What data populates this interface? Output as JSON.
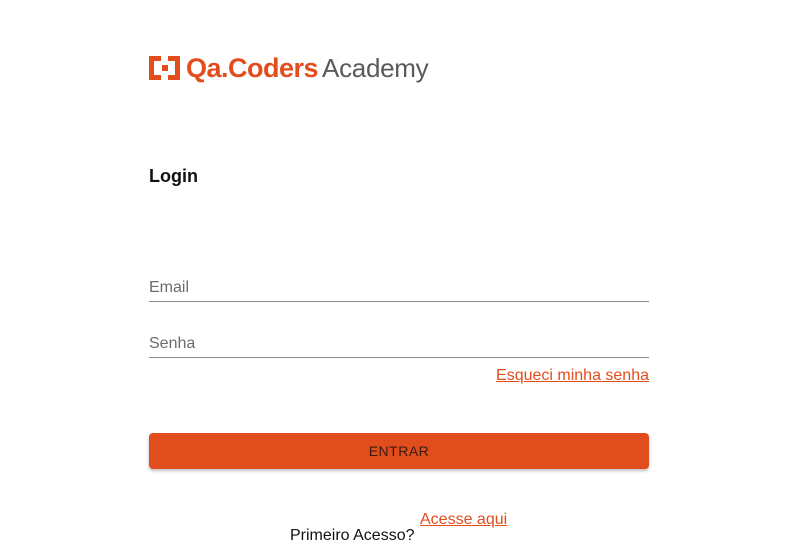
{
  "logo": {
    "brand": "Qa.Coders",
    "sub": "Academy",
    "icon": "qacoders-logo-mark",
    "brand_color": "#e24d1d"
  },
  "login": {
    "title": "Login",
    "email_placeholder": "Email",
    "email_value": "",
    "password_placeholder": "Senha",
    "password_value": "",
    "forgot_link": "Esqueci minha senha",
    "submit_label": "ENTRAR",
    "first_access_label": "Primeiro Acesso?",
    "access_link": "Acesse aqui"
  },
  "colors": {
    "accent": "#e24d1d",
    "text": "#111111",
    "muted": "#6b6b6b"
  }
}
